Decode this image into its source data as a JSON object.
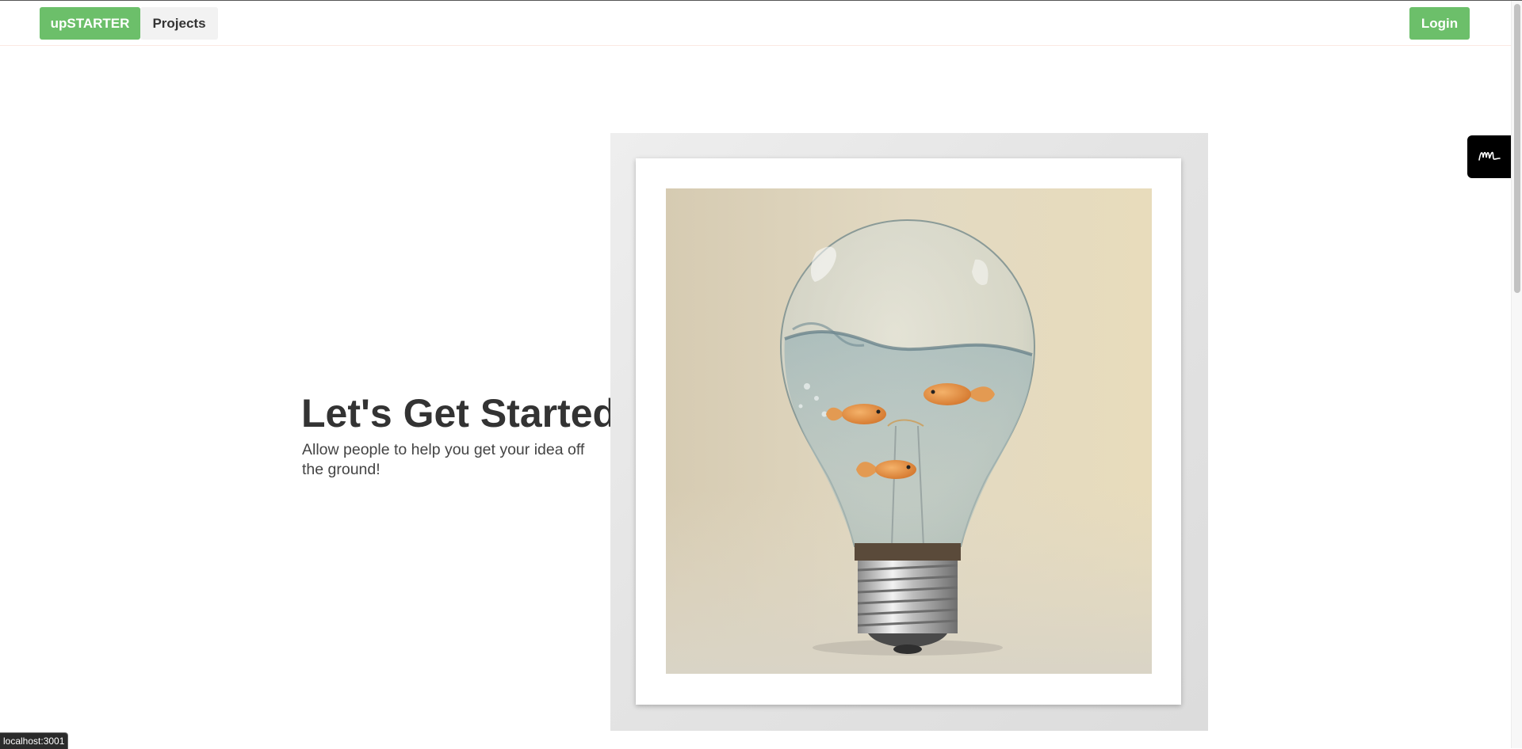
{
  "navbar": {
    "brand_label": "upSTARTER",
    "projects_label": "Projects",
    "login_label": "Login"
  },
  "hero": {
    "title": "Let's Get Started",
    "subtitle": "Allow people to help you get your idea off the ground!"
  },
  "artwork": {
    "image_alt": "Light bulb with goldfish swimming in water"
  },
  "extension_widget": {
    "icon": "signature-icon"
  },
  "status_bar": {
    "url": "localhost:3001"
  },
  "colors": {
    "accent_green": "#6cbf6a",
    "text_dark": "#333333",
    "frame_gray": "#e4e4e4"
  }
}
